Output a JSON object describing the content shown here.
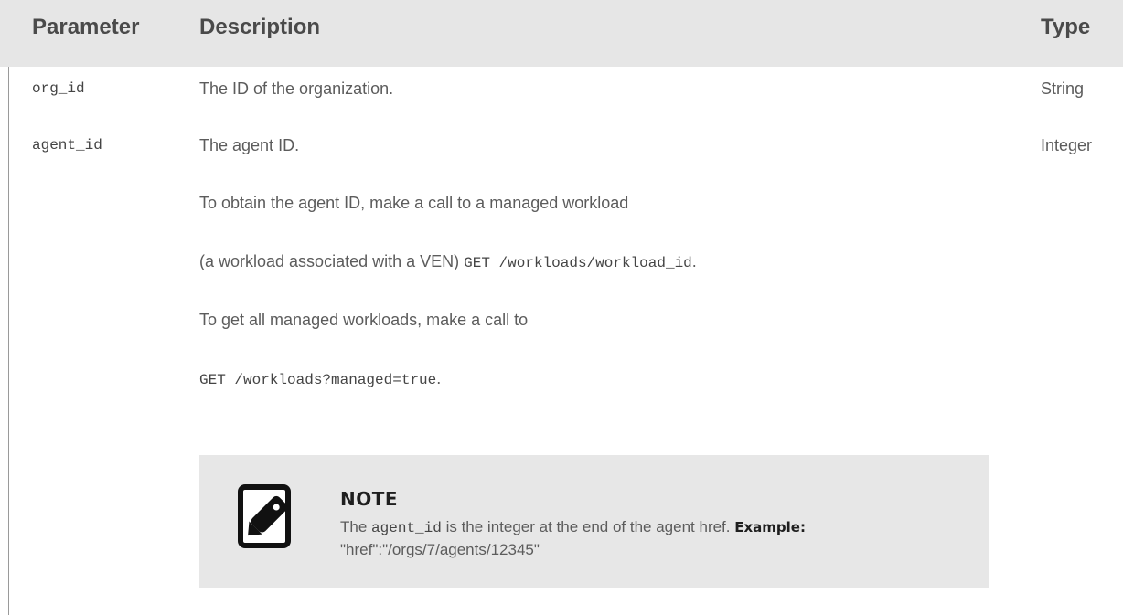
{
  "table": {
    "headers": {
      "parameter": "Parameter",
      "description": "Description",
      "type": "Type"
    },
    "rows": [
      {
        "parameter": "org_id",
        "description": "The ID of the organization.",
        "type": "String"
      },
      {
        "parameter": "agent_id",
        "description": "The agent ID.",
        "type": "Integer"
      }
    ],
    "agent_details": {
      "line1": "To obtain the agent ID, make a call to a managed workload",
      "line2_prefix": "(a workload associated with a VEN) ",
      "line2_code": "GET /workloads/workload_id",
      "line2_suffix": ".",
      "line3": "To get all managed workloads, make a call to",
      "line4_code": "GET /workloads?managed=true",
      "line4_suffix": "."
    }
  },
  "note": {
    "icon": "note-pencil-icon",
    "title": "NOTE",
    "text_prefix": "The ",
    "text_code": "agent_id",
    "text_middle": " is the integer at the end of the agent href. ",
    "text_bold": "Example:",
    "text_example": "\"href\":\"/orgs/7/agents/12345\""
  }
}
